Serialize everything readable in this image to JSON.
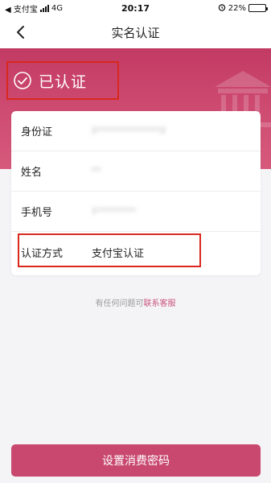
{
  "status_bar": {
    "carrier": "◀ 支付宝",
    "network": "4G",
    "time": "20:17",
    "battery": "22%",
    "battery_level": 0.22
  },
  "nav": {
    "title": "实名认证"
  },
  "hero": {
    "verified_text": "已认证"
  },
  "info": {
    "rows": [
      {
        "label": "身份证",
        "value": "2*************2"
      },
      {
        "label": "姓名",
        "value": "**"
      },
      {
        "label": "手机号",
        "value": "1********"
      },
      {
        "label": "认证方式",
        "value": "支付宝认证"
      }
    ]
  },
  "help": {
    "prefix": "有任何问题可",
    "link": "联系客服"
  },
  "bottom_button": {
    "label": "设置消费密码"
  },
  "colors": {
    "accent": "#c8486f",
    "hero": "#c23a63",
    "highlight_box": "#d9281e"
  }
}
